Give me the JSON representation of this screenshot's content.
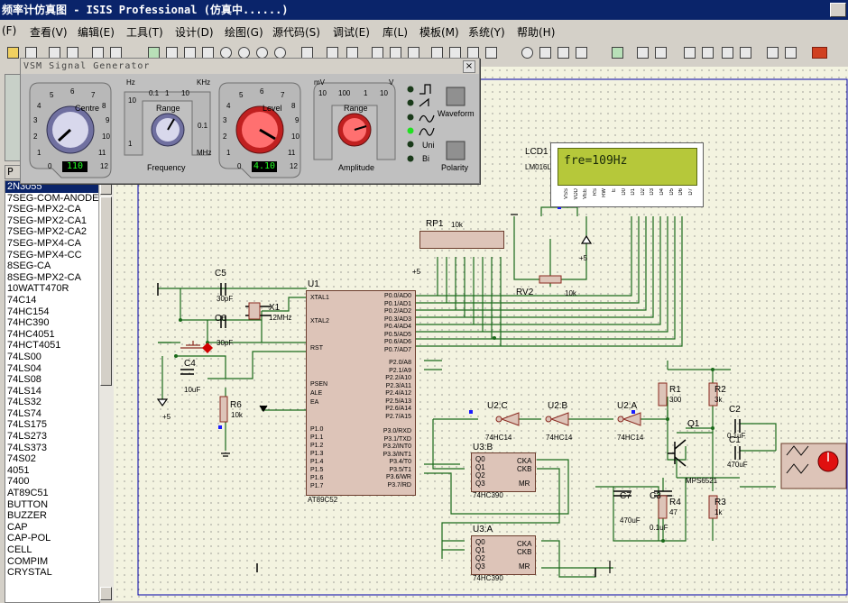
{
  "title": "频率计仿真图 - ISIS Professional (仿真中......)",
  "menu": [
    "(F)",
    "查看(V)",
    "编辑(E)",
    "工具(T)",
    "设计(D)",
    "绘图(G)",
    "源代码(S)",
    "调试(E)",
    "库(L)",
    "模板(M)",
    "系统(Y)",
    "帮助(H)"
  ],
  "left_tab": "P",
  "devices": [
    "2N3055",
    "7SEG-COM-ANODE",
    "7SEG-MPX2-CA",
    "7SEG-MPX2-CA1",
    "7SEG-MPX2-CA2",
    "7SEG-MPX4-CA",
    "7SEG-MPX4-CC",
    "8SEG-CA",
    "8SEG-MPX2-CA",
    "10WATT470R",
    "74C14",
    "74HC154",
    "74HC390",
    "74HC4051",
    "74HCT4051",
    "74LS00",
    "74LS04",
    "74LS08",
    "74LS14",
    "74LS32",
    "74LS74",
    "74LS175",
    "74LS273",
    "74LS373",
    "74S02",
    "4051",
    "7400",
    "AT89C51",
    "BUTTON",
    "BUZZER",
    "CAP",
    "CAP-POL",
    "CELL",
    "COMPIM",
    "CRYSTAL"
  ],
  "selected_device": "2N3055",
  "generator": {
    "title": "VSM Signal Generator",
    "centre_label": "Centre",
    "centre_value": "110",
    "range_label": "Range",
    "frequency_label": "Frequency",
    "level_label": "Level",
    "level_value": "4.10",
    "range2_label": "Range",
    "amplitude_label": "Amplitude",
    "waveform_label": "Waveform",
    "polarity_label": "Polarity",
    "uni_label": "Uni",
    "bi_label": "Bi",
    "freq_units": {
      "hz": "Hz",
      "khz": "KHz",
      "mhz": "MHz"
    },
    "amp_units": {
      "mv": "mV",
      "v": "V"
    },
    "centre_scale": [
      "0",
      "1",
      "2",
      "3",
      "4",
      "5",
      "6",
      "7",
      "8",
      "9",
      "10",
      "11",
      "12"
    ],
    "range_scale": [
      "0.1",
      "1",
      "10",
      "0.1",
      "1",
      "10"
    ],
    "level_scale": [
      "0",
      "1",
      "2",
      "3",
      "4",
      "5",
      "6",
      "7",
      "8",
      "9",
      "10",
      "11",
      "12"
    ],
    "amp_range_scale": [
      "10",
      "100",
      "1",
      "10"
    ]
  },
  "lcd": {
    "ref": "LCD1",
    "model": "LM016L",
    "text": "fre=109Hz",
    "pins": [
      "VSS",
      "VDD",
      "VEE",
      "RS",
      "RW",
      "E",
      "D0",
      "D1",
      "D2",
      "D3",
      "D4",
      "D5",
      "D6",
      "D7"
    ]
  },
  "components": {
    "u1": "U1",
    "u1_model": "AT89C52",
    "u1_left_pins": [
      "XTAL1",
      "XTAL2",
      "RST",
      "PSEN",
      "ALE",
      "EA",
      "P1.0",
      "P1.1",
      "P1.2",
      "P1.3",
      "P1.4",
      "P1.5",
      "P1.6",
      "P1.7"
    ],
    "u1_right_pins": [
      "P0.0/AD0",
      "P0.1/AD1",
      "P0.2/AD2",
      "P0.3/AD3",
      "P0.4/AD4",
      "P0.5/AD5",
      "P0.6/AD6",
      "P0.7/AD7",
      "P2.0/A8",
      "P2.1/A9",
      "P2.2/A10",
      "P2.3/A11",
      "P2.4/A12",
      "P2.5/A13",
      "P2.6/A14",
      "P2.7/A15",
      "P3.0/RXD",
      "P3.1/TXD",
      "P3.2/INT0",
      "P3.3/INT1",
      "P3.4/T0",
      "P3.5/T1",
      "P3.6/WR",
      "P3.7/RD"
    ],
    "rp1": "RP1",
    "rp1_val": "10k",
    "rv2": "RV2",
    "rv2_val": "10k",
    "c5": "C5",
    "c5_val": "30pF",
    "c6": "C6",
    "c6_val": "30pF",
    "x1": "X1",
    "x1_val": "12MHz",
    "c4": "C4",
    "c4_val": "10uF",
    "r6": "R6",
    "r6_val": "10k",
    "u2c": "U2:C",
    "u2b": "U2:B",
    "u2a": "U2:A",
    "u2_model": "74HC14",
    "u3b": "U3:B",
    "u3a": "U3:A",
    "u3_model": "74HC390",
    "r1": "R1",
    "r1_val": "300",
    "r2": "R2",
    "r2_val": "3k",
    "q1": "Q1",
    "q1_model": "MPS6521",
    "c2": "C2",
    "c2_val": "0.1uF",
    "c1": "C1",
    "c1_val": "470uF",
    "c7": "C7",
    "c7_val": "470uF",
    "c3": "C3",
    "c3_val": "0.1uF",
    "r4": "R4",
    "r4_val": "47",
    "r3": "R3",
    "r3_val": "1k",
    "plus5": "+5",
    "plus5b": "+5",
    "plus5c": "+5",
    "u3_pins_q": [
      "Q0",
      "Q1",
      "Q2",
      "Q3"
    ],
    "u3_pins_r": [
      "CKA",
      "CKB",
      "MR"
    ]
  }
}
